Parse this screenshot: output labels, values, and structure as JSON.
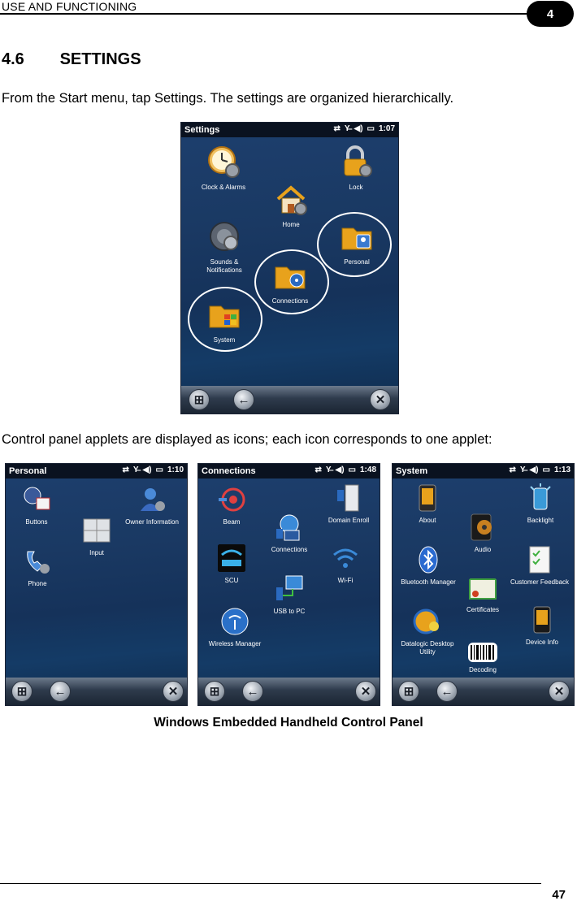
{
  "header": {
    "text": "USE AND FUNCTIONING",
    "chapter": "4"
  },
  "section": {
    "number": "4.6",
    "title": "SETTINGS"
  },
  "para1": "From the Start menu, tap Settings. The settings are organized hierarchically.",
  "para2": "Control panel applets are displayed as icons; each icon corresponds to one applet:",
  "caption": "Windows Embedded Handheld Control Panel",
  "page_number": "47",
  "settings_screen": {
    "title": "Settings",
    "time": "1:07",
    "items": [
      "Clock & Alarms",
      "Lock",
      "Home",
      "Sounds & Notifications",
      "Personal",
      "Connections",
      "System"
    ]
  },
  "personal_screen": {
    "title": "Personal",
    "time": "1:10",
    "items": [
      "Buttons",
      "Owner Information",
      "Input",
      "Phone"
    ]
  },
  "connections_screen": {
    "title": "Connections",
    "time": "1:48",
    "items": [
      "Beam",
      "Domain Enroll",
      "Connections",
      "SCU",
      "Wi-Fi",
      "USB to PC",
      "Wireless Manager"
    ]
  },
  "system_screen": {
    "title": "System",
    "time": "1:13",
    "items": [
      "About",
      "Backlight",
      "Audio",
      "Bluetooth Manager",
      "Customer Feedback",
      "Certificates",
      "Datalogic Desktop Utility",
      "Device Info",
      "Decoding"
    ]
  },
  "colors": {
    "screen_bg": "#1a3963",
    "titlebar": "#0a1220",
    "folder": "#e8a21c"
  }
}
